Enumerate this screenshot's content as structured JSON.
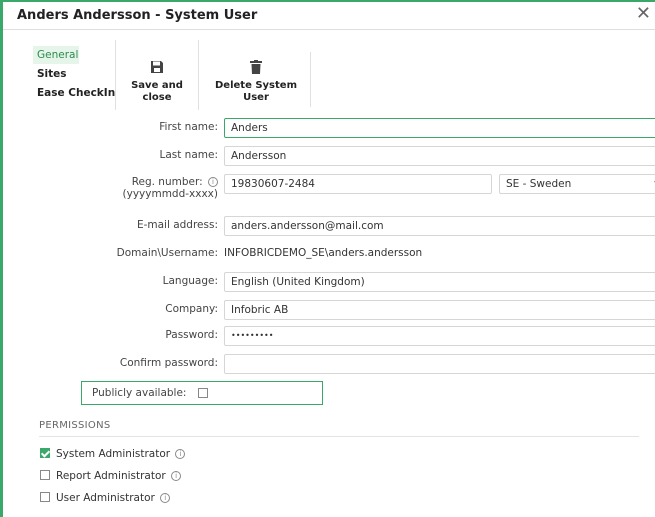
{
  "window": {
    "title": "Anders Andersson - System User",
    "close_glyph": "✕"
  },
  "nav": {
    "items": [
      "General",
      "Sites",
      "Ease CheckIn"
    ],
    "active": "General"
  },
  "toolbar": {
    "save_label_1": "Save and",
    "save_label_2": "close",
    "save_icon": "floppy-disk-icon",
    "delete_label_1": "Delete System",
    "delete_label_2": "User",
    "delete_icon": "trash-icon"
  },
  "form": {
    "first_name": {
      "label": "First name:",
      "value": "Anders"
    },
    "last_name": {
      "label": "Last name:",
      "value": "Andersson"
    },
    "reg_number": {
      "label": "Reg. number:",
      "sublabel": "(yyyymmdd-xxxx)",
      "value": "19830607-2484",
      "country": "SE - Sweden"
    },
    "email": {
      "label": "E-mail address:",
      "value": "anders.andersson@mail.com"
    },
    "domain": {
      "label": "Domain\\Username:",
      "value": "INFOBRICDEMO_SE\\anders.andersson"
    },
    "language": {
      "label": "Language:",
      "value": "English (United Kingdom)"
    },
    "company": {
      "label": "Company:",
      "value": "Infobric AB"
    },
    "password": {
      "label": "Password:",
      "value": "•••••••••"
    },
    "confirm_password": {
      "label": "Confirm password:",
      "value": ""
    },
    "publicly_available": {
      "label": "Publicly available:",
      "checked": false
    }
  },
  "permissions": {
    "header": "PERMISSIONS",
    "items": [
      {
        "label": "System Administrator",
        "checked": true
      },
      {
        "label": "Report Administrator",
        "checked": false
      },
      {
        "label": "User Administrator",
        "checked": false
      }
    ]
  },
  "colors": {
    "accent": "#3aa86a"
  },
  "info_glyph": "i"
}
